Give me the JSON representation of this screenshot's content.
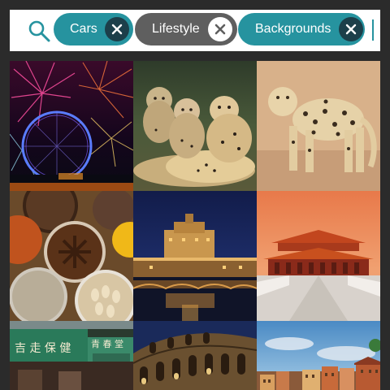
{
  "search": {
    "icon": "search-icon",
    "chips": [
      {
        "label": "Cars",
        "color": "#26939f",
        "close_icon": "close-icon"
      },
      {
        "label": "Lifestyle",
        "color": "#5f5f5f",
        "close_icon": "close-icon"
      },
      {
        "label": "Backgrounds",
        "color": "#26939f",
        "close_icon": "close-icon"
      }
    ]
  },
  "colors": {
    "teal": "#26939f",
    "gray_chip": "#5f5f5f",
    "background": "#2b2b2b"
  },
  "gallery": {
    "tiles": [
      {
        "name": "fireworks-ferris-wheel-photo"
      },
      {
        "name": "cheetahs-photo"
      },
      {
        "name": "leopard-photo"
      },
      {
        "name": "spices-photo"
      },
      {
        "name": "castle-sant-angelo-night-photo"
      },
      {
        "name": "forbidden-city-photo"
      },
      {
        "name": "chinese-street-signs-photo",
        "sign_text": "吉 走 保 健",
        "sign_text_2": "青 春 堂"
      },
      {
        "name": "colosseum-photo"
      },
      {
        "name": "coastal-town-photo"
      }
    ]
  }
}
